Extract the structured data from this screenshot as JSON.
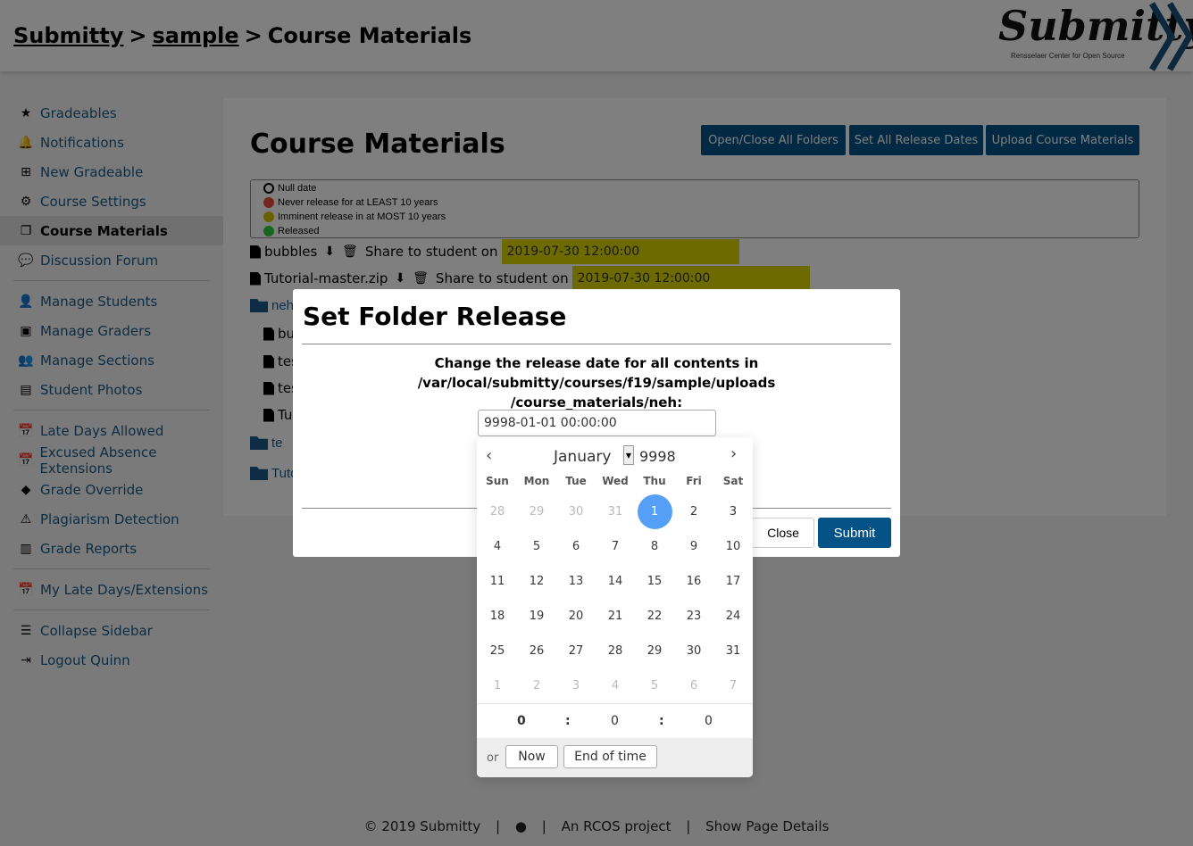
{
  "header": {
    "crumb_home": "Submitty",
    "crumb_course": "sample",
    "crumb_sep": ">",
    "crumb_page": "Course Materials",
    "logo_text": "Submitty",
    "logo_sub": "Rensselaer Center for Open Source"
  },
  "sidebar": {
    "items": [
      {
        "label": "Gradeables",
        "icon": "star-icon"
      },
      {
        "label": "Notifications",
        "icon": "bell-icon"
      },
      {
        "label": "New Gradeable",
        "icon": "plus-square-icon"
      },
      {
        "label": "Course Settings",
        "icon": "gear-icon"
      },
      {
        "label": "Course Materials",
        "icon": "copy-icon"
      },
      {
        "label": "Discussion Forum",
        "icon": "comments-icon"
      },
      {
        "label": "Manage Students",
        "icon": "user-graduate-icon"
      },
      {
        "label": "Manage Graders",
        "icon": "address-book-icon"
      },
      {
        "label": "Manage Sections",
        "icon": "users-icon"
      },
      {
        "label": "Student Photos",
        "icon": "id-card-icon"
      },
      {
        "label": "Late Days Allowed",
        "icon": "calendar-check-icon"
      },
      {
        "label": "Excused Absence Extensions",
        "icon": "calendar-plus-icon"
      },
      {
        "label": "Grade Override",
        "icon": "eraser-icon"
      },
      {
        "label": "Plagiarism Detection",
        "icon": "warning-icon"
      },
      {
        "label": "Grade Reports",
        "icon": "chart-icon"
      },
      {
        "label": "My Late Days/Extensions",
        "icon": "calendar-icon"
      },
      {
        "label": "Collapse Sidebar",
        "icon": "bars-icon"
      },
      {
        "label": "Logout Quinn",
        "icon": "sign-out-icon"
      }
    ]
  },
  "main": {
    "title": "Course Materials",
    "btn_open_close": "Open/Close All Folders",
    "btn_set_release": "Set All Release Dates",
    "btn_upload": "Upload Course Materials",
    "legend": [
      {
        "label": "Null date",
        "color": "#ffffff"
      },
      {
        "label": "Never release for at LEAST 10 years",
        "color": "#e74c3c"
      },
      {
        "label": "Imminent release in at MOST 10 years",
        "color": "#d4c200"
      },
      {
        "label": "Released",
        "color": "#2ecc40"
      }
    ],
    "files": [
      {
        "name": "bubbles",
        "share_label": "Share to student on",
        "date": "2019-07-30 12:00:00"
      },
      {
        "name": "Tutorial-master.zip",
        "share_label": "Share to student on",
        "date": "2019-07-30 12:00:00"
      }
    ],
    "folder_neh": "neh",
    "sub_bu": "bu",
    "sub_tes1": "tes",
    "sub_tes2": "tes",
    "sub_tu": "Tu",
    "folder_te": "te",
    "folder_tut": "Tuto"
  },
  "modal": {
    "title": "Set Folder Release",
    "message_line1": "Change the release date for all contents in /var/local/submitty/courses/f19/sample/uploads",
    "message_line2": "/course_materials/neh:",
    "input_value": "9998-01-01 00:00:00",
    "close_label": "Close",
    "submit_label": "Submit"
  },
  "calendar": {
    "month": "January",
    "year": "9998",
    "dow": [
      "Sun",
      "Mon",
      "Tue",
      "Wed",
      "Thu",
      "Fri",
      "Sat"
    ],
    "weeks": [
      [
        "28",
        "29",
        "30",
        "31",
        "1",
        "2",
        "3"
      ],
      [
        "4",
        "5",
        "6",
        "7",
        "8",
        "9",
        "10"
      ],
      [
        "11",
        "12",
        "13",
        "14",
        "15",
        "16",
        "17"
      ],
      [
        "18",
        "19",
        "20",
        "21",
        "22",
        "23",
        "24"
      ],
      [
        "25",
        "26",
        "27",
        "28",
        "29",
        "30",
        "31"
      ],
      [
        "1",
        "2",
        "3",
        "4",
        "5",
        "6",
        "7"
      ]
    ],
    "selected": "1",
    "hour": "0",
    "minute": "0",
    "second": "0",
    "time_sep": ":",
    "or_label": "or",
    "now_label": "Now",
    "end_label": "End of time"
  },
  "footer": {
    "copyright": "© 2019 Submitty",
    "sep": "|",
    "rcos": "An RCOS project",
    "details": "Show Page Details"
  }
}
